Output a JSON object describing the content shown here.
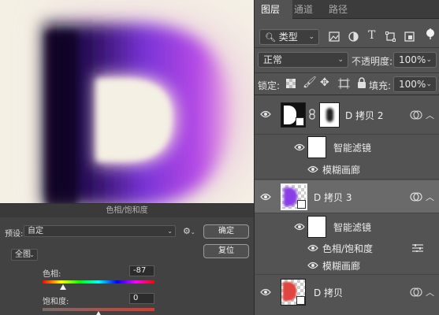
{
  "colors": {
    "panel_bg": "#535353",
    "canvas_bg": "#f4f0e4",
    "selected_row": "#6a6a6a",
    "d_purple": "#8a3ee8"
  },
  "canvas": {
    "letter": "D"
  },
  "dialog": {
    "title": "色相/饱和度",
    "preset_label": "预设:",
    "preset_value": "自定",
    "ok_label": "确定",
    "reset_label": "复位",
    "channel_value": "全图",
    "hue_label": "色相:",
    "hue_value": "-87",
    "saturation_label": "饱和度:",
    "saturation_value": "0"
  },
  "panel": {
    "tabs": [
      {
        "label": "图层"
      },
      {
        "label": "通道"
      },
      {
        "label": "路径"
      }
    ],
    "filter_kind": "类型",
    "blend_mode": "正常",
    "opacity_label": "不透明度:",
    "opacity_value": "100%",
    "lock_label": "锁定:",
    "fill_label": "填充:",
    "fill_value": "100%",
    "layers": [
      {
        "name": "D 拷贝 2"
      },
      {
        "name": "D 拷贝 3"
      },
      {
        "name": "D 拷贝"
      }
    ],
    "filters": {
      "smart_filters_label": "智能滤镜",
      "motion_blur_label": "模糊画廊",
      "hue_sat_label": "色相/饱和度"
    }
  }
}
